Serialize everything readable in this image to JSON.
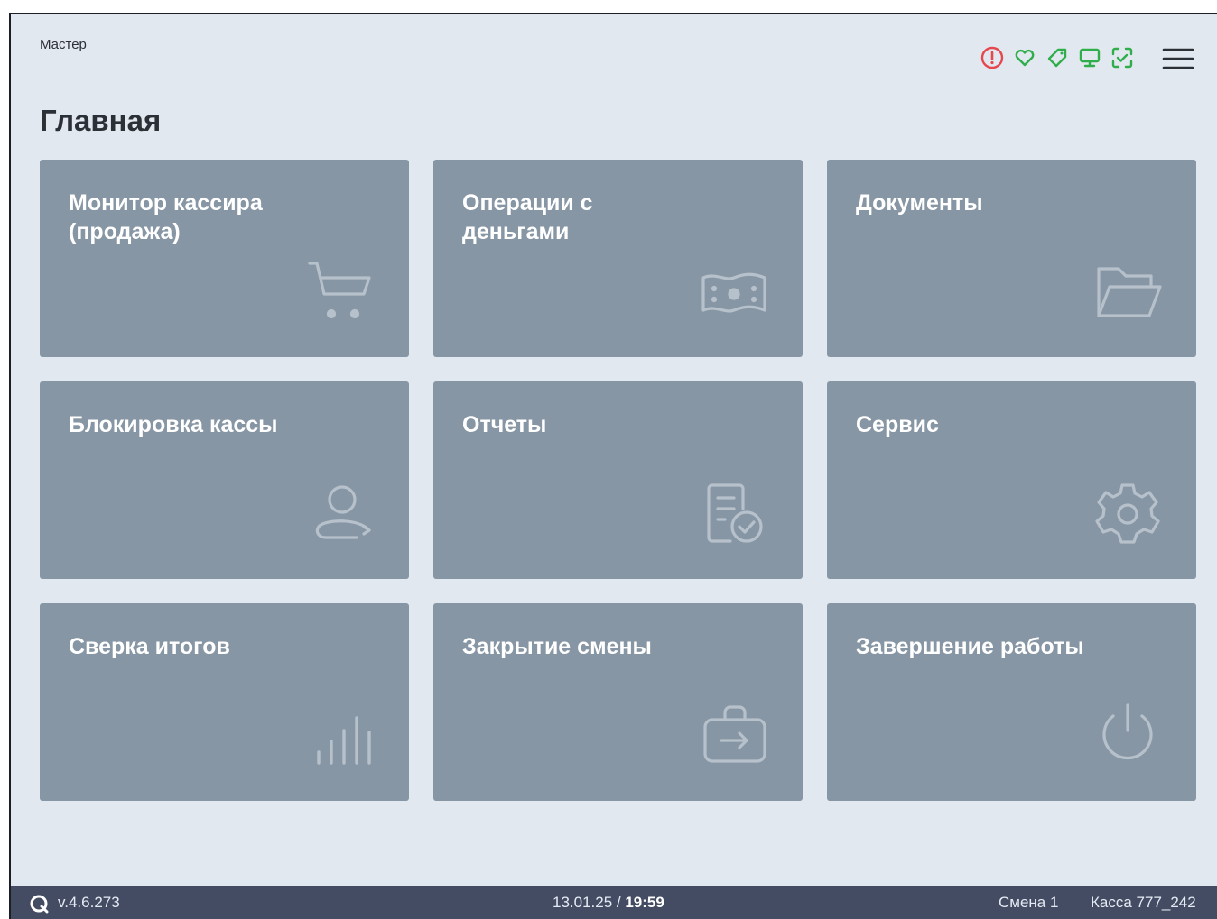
{
  "header": {
    "user": "Мастер",
    "title": "Главная",
    "status_icons": [
      "alert-circle-icon",
      "heart-icon",
      "tag-icon",
      "pos-terminal-icon",
      "scan-check-icon"
    ],
    "alert_color": "#e5484d",
    "ok_color": "#2fae4b",
    "menu_icon": "hamburger-menu-icon"
  },
  "tiles": [
    {
      "label": "Монитор кассира\n(продажа)",
      "icon": "cart-icon"
    },
    {
      "label": "Операции с\nденьгами",
      "icon": "money-icon"
    },
    {
      "label": "Документы",
      "icon": "folder-icon"
    },
    {
      "label": "Блокировка кассы",
      "icon": "user-icon"
    },
    {
      "label": "Отчеты",
      "icon": "report-check-icon"
    },
    {
      "label": "Сервис",
      "icon": "gear-icon"
    },
    {
      "label": "Сверка итогов",
      "icon": "bar-chart-icon"
    },
    {
      "label": "Закрытие смены",
      "icon": "bag-arrow-icon"
    },
    {
      "label": "Завершение работы",
      "icon": "power-icon"
    }
  ],
  "footer": {
    "version": "v.4.6.273",
    "date": "13.01.25 / ",
    "time": "19:59",
    "shift": "Смена 1",
    "register": "Касса 777_242"
  },
  "colors": {
    "background": "#e2e8ef",
    "tile": "#8796a4",
    "footer": "#434c63"
  }
}
